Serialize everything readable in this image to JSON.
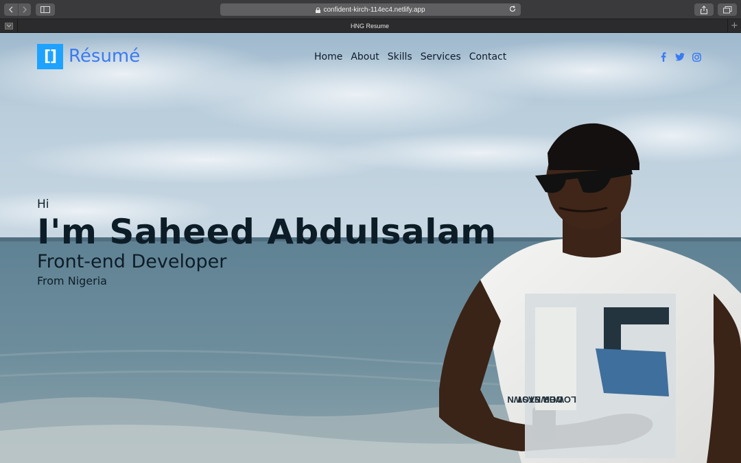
{
  "browser": {
    "url": "confident-kirch-114ec4.netlify.app",
    "tab_title": "HNG Resume"
  },
  "site": {
    "logo_mark": "[]",
    "logo_text": "Résumé",
    "nav": [
      "Home",
      "About",
      "Skills",
      "Services",
      "Contact"
    ],
    "social_icons": [
      "facebook-icon",
      "twitter-icon",
      "instagram-icon"
    ],
    "accent_color": "#1ea2ff",
    "social_color": "#3a7bf0"
  },
  "hero": {
    "greeting": "Hi",
    "name": "I'm Saheed Abdulsalam",
    "role": "Front-end Developer",
    "location": "From Nigeria"
  }
}
